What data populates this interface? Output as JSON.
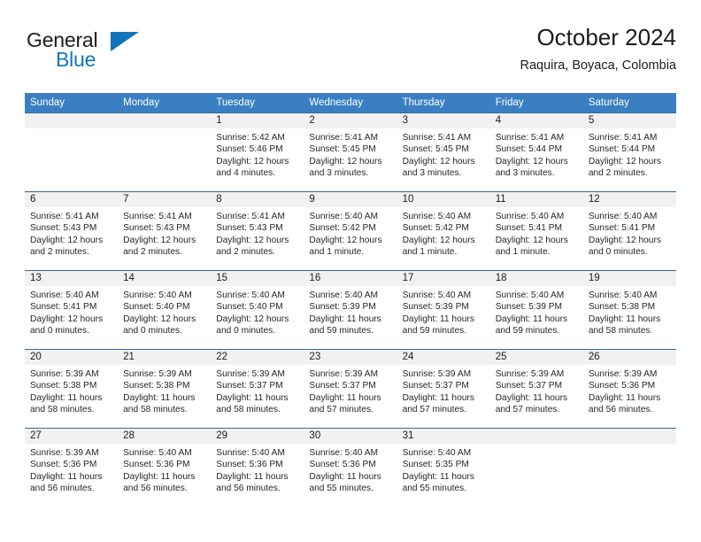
{
  "brand": {
    "name_part1": "General",
    "name_part2": "Blue",
    "triangle_icon": "triangle-icon",
    "color_primary": "#1474bb",
    "color_text": "#1b1b1b"
  },
  "header": {
    "title": "October 2024",
    "subtitle": "Raquira, Boyaca, Colombia"
  },
  "calendar": {
    "header_bg": "#3a7fc1",
    "header_text_color": "#ffffff",
    "daynum_band_bg": "#f1f1f1",
    "weekday_headers": [
      "Sunday",
      "Monday",
      "Tuesday",
      "Wednesday",
      "Thursday",
      "Friday",
      "Saturday"
    ],
    "labels": {
      "sunrise_prefix": "Sunrise:",
      "sunset_prefix": "Sunset:",
      "daylight_prefix": "Daylight:"
    },
    "weeks": [
      [
        {
          "day": "",
          "blank": true,
          "sunrise": "",
          "sunset": "",
          "daylight_line1": "",
          "daylight_line2": ""
        },
        {
          "day": "",
          "blank": true,
          "sunrise": "",
          "sunset": "",
          "daylight_line1": "",
          "daylight_line2": ""
        },
        {
          "day": "1",
          "blank": false,
          "sunrise": "Sunrise: 5:42 AM",
          "sunset": "Sunset: 5:46 PM",
          "daylight_line1": "Daylight: 12 hours",
          "daylight_line2": "and 4 minutes."
        },
        {
          "day": "2",
          "blank": false,
          "sunrise": "Sunrise: 5:41 AM",
          "sunset": "Sunset: 5:45 PM",
          "daylight_line1": "Daylight: 12 hours",
          "daylight_line2": "and 3 minutes."
        },
        {
          "day": "3",
          "blank": false,
          "sunrise": "Sunrise: 5:41 AM",
          "sunset": "Sunset: 5:45 PM",
          "daylight_line1": "Daylight: 12 hours",
          "daylight_line2": "and 3 minutes."
        },
        {
          "day": "4",
          "blank": false,
          "sunrise": "Sunrise: 5:41 AM",
          "sunset": "Sunset: 5:44 PM",
          "daylight_line1": "Daylight: 12 hours",
          "daylight_line2": "and 3 minutes."
        },
        {
          "day": "5",
          "blank": false,
          "sunrise": "Sunrise: 5:41 AM",
          "sunset": "Sunset: 5:44 PM",
          "daylight_line1": "Daylight: 12 hours",
          "daylight_line2": "and 2 minutes."
        }
      ],
      [
        {
          "day": "6",
          "blank": false,
          "sunrise": "Sunrise: 5:41 AM",
          "sunset": "Sunset: 5:43 PM",
          "daylight_line1": "Daylight: 12 hours",
          "daylight_line2": "and 2 minutes."
        },
        {
          "day": "7",
          "blank": false,
          "sunrise": "Sunrise: 5:41 AM",
          "sunset": "Sunset: 5:43 PM",
          "daylight_line1": "Daylight: 12 hours",
          "daylight_line2": "and 2 minutes."
        },
        {
          "day": "8",
          "blank": false,
          "sunrise": "Sunrise: 5:41 AM",
          "sunset": "Sunset: 5:43 PM",
          "daylight_line1": "Daylight: 12 hours",
          "daylight_line2": "and 2 minutes."
        },
        {
          "day": "9",
          "blank": false,
          "sunrise": "Sunrise: 5:40 AM",
          "sunset": "Sunset: 5:42 PM",
          "daylight_line1": "Daylight: 12 hours",
          "daylight_line2": "and 1 minute."
        },
        {
          "day": "10",
          "blank": false,
          "sunrise": "Sunrise: 5:40 AM",
          "sunset": "Sunset: 5:42 PM",
          "daylight_line1": "Daylight: 12 hours",
          "daylight_line2": "and 1 minute."
        },
        {
          "day": "11",
          "blank": false,
          "sunrise": "Sunrise: 5:40 AM",
          "sunset": "Sunset: 5:41 PM",
          "daylight_line1": "Daylight: 12 hours",
          "daylight_line2": "and 1 minute."
        },
        {
          "day": "12",
          "blank": false,
          "sunrise": "Sunrise: 5:40 AM",
          "sunset": "Sunset: 5:41 PM",
          "daylight_line1": "Daylight: 12 hours",
          "daylight_line2": "and 0 minutes."
        }
      ],
      [
        {
          "day": "13",
          "blank": false,
          "sunrise": "Sunrise: 5:40 AM",
          "sunset": "Sunset: 5:41 PM",
          "daylight_line1": "Daylight: 12 hours",
          "daylight_line2": "and 0 minutes."
        },
        {
          "day": "14",
          "blank": false,
          "sunrise": "Sunrise: 5:40 AM",
          "sunset": "Sunset: 5:40 PM",
          "daylight_line1": "Daylight: 12 hours",
          "daylight_line2": "and 0 minutes."
        },
        {
          "day": "15",
          "blank": false,
          "sunrise": "Sunrise: 5:40 AM",
          "sunset": "Sunset: 5:40 PM",
          "daylight_line1": "Daylight: 12 hours",
          "daylight_line2": "and 0 minutes."
        },
        {
          "day": "16",
          "blank": false,
          "sunrise": "Sunrise: 5:40 AM",
          "sunset": "Sunset: 5:39 PM",
          "daylight_line1": "Daylight: 11 hours",
          "daylight_line2": "and 59 minutes."
        },
        {
          "day": "17",
          "blank": false,
          "sunrise": "Sunrise: 5:40 AM",
          "sunset": "Sunset: 5:39 PM",
          "daylight_line1": "Daylight: 11 hours",
          "daylight_line2": "and 59 minutes."
        },
        {
          "day": "18",
          "blank": false,
          "sunrise": "Sunrise: 5:40 AM",
          "sunset": "Sunset: 5:39 PM",
          "daylight_line1": "Daylight: 11 hours",
          "daylight_line2": "and 59 minutes."
        },
        {
          "day": "19",
          "blank": false,
          "sunrise": "Sunrise: 5:40 AM",
          "sunset": "Sunset: 5:38 PM",
          "daylight_line1": "Daylight: 11 hours",
          "daylight_line2": "and 58 minutes."
        }
      ],
      [
        {
          "day": "20",
          "blank": false,
          "sunrise": "Sunrise: 5:39 AM",
          "sunset": "Sunset: 5:38 PM",
          "daylight_line1": "Daylight: 11 hours",
          "daylight_line2": "and 58 minutes."
        },
        {
          "day": "21",
          "blank": false,
          "sunrise": "Sunrise: 5:39 AM",
          "sunset": "Sunset: 5:38 PM",
          "daylight_line1": "Daylight: 11 hours",
          "daylight_line2": "and 58 minutes."
        },
        {
          "day": "22",
          "blank": false,
          "sunrise": "Sunrise: 5:39 AM",
          "sunset": "Sunset: 5:37 PM",
          "daylight_line1": "Daylight: 11 hours",
          "daylight_line2": "and 58 minutes."
        },
        {
          "day": "23",
          "blank": false,
          "sunrise": "Sunrise: 5:39 AM",
          "sunset": "Sunset: 5:37 PM",
          "daylight_line1": "Daylight: 11 hours",
          "daylight_line2": "and 57 minutes."
        },
        {
          "day": "24",
          "blank": false,
          "sunrise": "Sunrise: 5:39 AM",
          "sunset": "Sunset: 5:37 PM",
          "daylight_line1": "Daylight: 11 hours",
          "daylight_line2": "and 57 minutes."
        },
        {
          "day": "25",
          "blank": false,
          "sunrise": "Sunrise: 5:39 AM",
          "sunset": "Sunset: 5:37 PM",
          "daylight_line1": "Daylight: 11 hours",
          "daylight_line2": "and 57 minutes."
        },
        {
          "day": "26",
          "blank": false,
          "sunrise": "Sunrise: 5:39 AM",
          "sunset": "Sunset: 5:36 PM",
          "daylight_line1": "Daylight: 11 hours",
          "daylight_line2": "and 56 minutes."
        }
      ],
      [
        {
          "day": "27",
          "blank": false,
          "sunrise": "Sunrise: 5:39 AM",
          "sunset": "Sunset: 5:36 PM",
          "daylight_line1": "Daylight: 11 hours",
          "daylight_line2": "and 56 minutes."
        },
        {
          "day": "28",
          "blank": false,
          "sunrise": "Sunrise: 5:40 AM",
          "sunset": "Sunset: 5:36 PM",
          "daylight_line1": "Daylight: 11 hours",
          "daylight_line2": "and 56 minutes."
        },
        {
          "day": "29",
          "blank": false,
          "sunrise": "Sunrise: 5:40 AM",
          "sunset": "Sunset: 5:36 PM",
          "daylight_line1": "Daylight: 11 hours",
          "daylight_line2": "and 56 minutes."
        },
        {
          "day": "30",
          "blank": false,
          "sunrise": "Sunrise: 5:40 AM",
          "sunset": "Sunset: 5:36 PM",
          "daylight_line1": "Daylight: 11 hours",
          "daylight_line2": "and 55 minutes."
        },
        {
          "day": "31",
          "blank": false,
          "sunrise": "Sunrise: 5:40 AM",
          "sunset": "Sunset: 5:35 PM",
          "daylight_line1": "Daylight: 11 hours",
          "daylight_line2": "and 55 minutes."
        },
        {
          "day": "",
          "blank": true,
          "sunrise": "",
          "sunset": "",
          "daylight_line1": "",
          "daylight_line2": ""
        },
        {
          "day": "",
          "blank": true,
          "sunrise": "",
          "sunset": "",
          "daylight_line1": "",
          "daylight_line2": ""
        }
      ]
    ]
  }
}
